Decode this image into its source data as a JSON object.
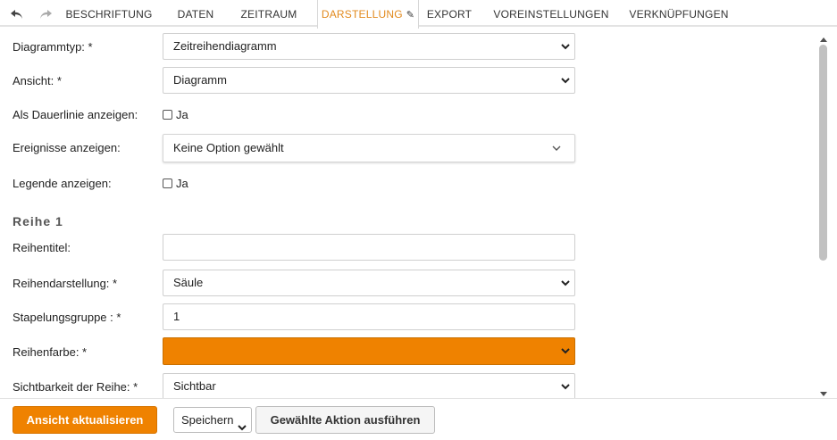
{
  "tabs": [
    {
      "label": "BESCHRIFTUNG",
      "active": false
    },
    {
      "label": "DATEN",
      "active": false
    },
    {
      "label": "ZEITRAUM",
      "active": false
    },
    {
      "label": "DARSTELLUNG",
      "active": true
    },
    {
      "label": "EXPORT",
      "active": false
    },
    {
      "label": "VOREINSTELLUNGEN",
      "active": false
    },
    {
      "label": "VERKNÜPFUNGEN",
      "active": false
    }
  ],
  "toolbar_icons": [
    "undo-icon",
    "redo-icon",
    "pencil-icon"
  ],
  "form": {
    "diagrammtyp": {
      "label": "Diagrammtyp: *",
      "value": "Zeitreihendiagramm"
    },
    "ansicht": {
      "label": "Ansicht: *",
      "value": "Diagramm"
    },
    "dauerlinie": {
      "label": "Als Dauerlinie anzeigen:",
      "option": "Ja",
      "checked": false
    },
    "ereignisse": {
      "label": "Ereignisse anzeigen:",
      "value": "Keine Option gewählt"
    },
    "legende": {
      "label": "Legende anzeigen:",
      "option": "Ja",
      "checked": false
    },
    "section": "Reihe 1",
    "reihentitel": {
      "label": "Reihentitel:",
      "value": ""
    },
    "reihendarstellung": {
      "label": "Reihendarstellung: *",
      "value": "Säule"
    },
    "stapelungsgruppe": {
      "label": "Stapelungsgruppe : *",
      "value": "1"
    },
    "reihenfarbe": {
      "label": "Reihenfarbe: *",
      "color": "#ef8200"
    },
    "sichtbarkeit": {
      "label": "Sichtbarkeit der Reihe: *",
      "value": "Sichtbar"
    }
  },
  "bottom": {
    "update_label": "Ansicht aktualisieren",
    "save_value": "Speichern",
    "action_label": "Gewählte Aktion ausführen"
  },
  "colors": {
    "accent": "#ef8200",
    "active_tab": "#e28a1e"
  }
}
